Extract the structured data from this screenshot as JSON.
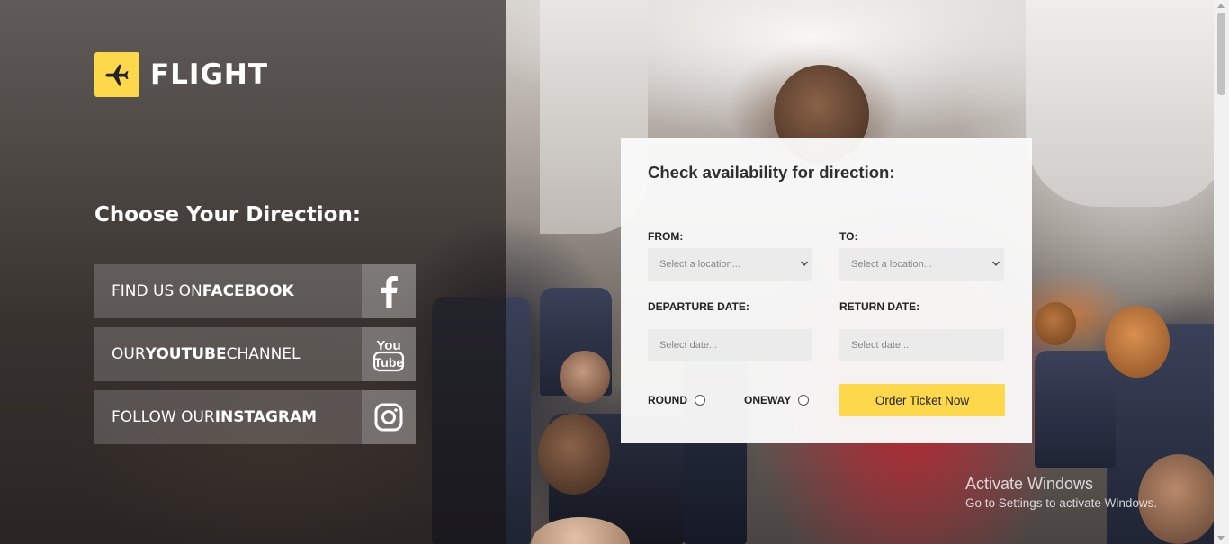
{
  "brand": {
    "name": "FLIGHT",
    "accent_color": "#fed84b",
    "icon": "airplane-icon"
  },
  "left_panel": {
    "title": "Choose Your Direction:",
    "social_links": [
      {
        "prefix": "FIND US ON ",
        "strong": "FACEBOOK",
        "suffix": "",
        "icon": "facebook-icon"
      },
      {
        "prefix": "OUR ",
        "strong": "YOUTUBE",
        "suffix": " CHANNEL",
        "icon": "youtube-icon"
      },
      {
        "prefix": "FOLLOW OUR ",
        "strong": "INSTAGRAM",
        "suffix": "",
        "icon": "instagram-icon"
      }
    ]
  },
  "form": {
    "title": "Check availability for direction:",
    "from_label": "FROM:",
    "from_placeholder": "Select a location...",
    "to_label": "TO:",
    "to_placeholder": "Select a location...",
    "departure_label": "DEPARTURE DATE:",
    "departure_placeholder": "Select date...",
    "return_label": "RETURN DATE:",
    "return_placeholder": "Select date...",
    "round_label": "ROUND",
    "oneway_label": "ONEWAY",
    "submit_label": "Order Ticket Now"
  },
  "watermark": {
    "title": "Activate Windows",
    "subtitle": "Go to Settings to activate Windows."
  }
}
